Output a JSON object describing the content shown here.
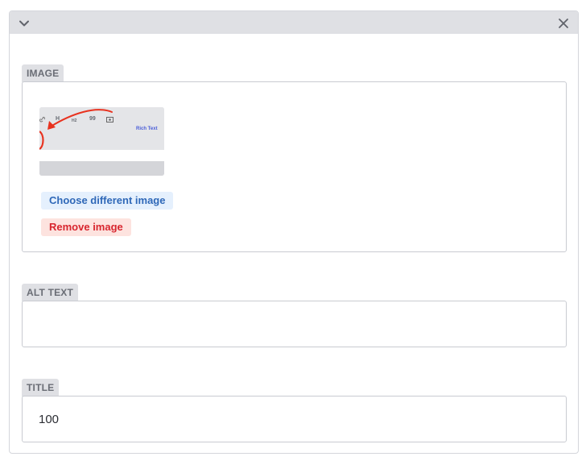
{
  "header": {
    "collapse_icon": "chevron-down-icon",
    "close_icon": "close-icon"
  },
  "image_field": {
    "label": "IMAGE",
    "thumbnail": {
      "caption": "Rich Text",
      "toolbar": [
        "H",
        "H2",
        "99"
      ]
    },
    "choose_label": "Choose different image",
    "remove_label": "Remove image"
  },
  "alt_field": {
    "label": "ALT TEXT",
    "value": ""
  },
  "title_field": {
    "label": "TITLE",
    "value": "100"
  },
  "colors": {
    "header_bg": "#dfe0e4",
    "choose_bg": "#e5f0fd",
    "choose_text": "#2f68b8",
    "remove_bg": "#fde3df",
    "remove_text": "#d8262f",
    "annotation_red": "#e8321f"
  }
}
